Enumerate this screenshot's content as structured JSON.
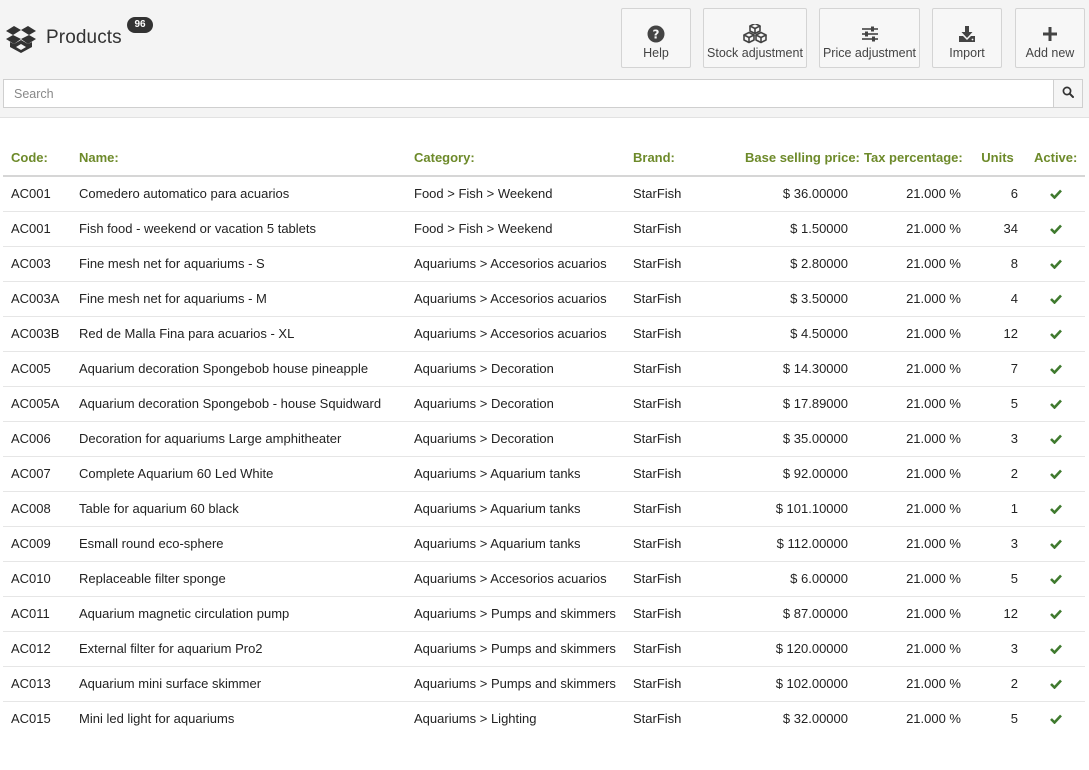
{
  "header": {
    "title": "Products",
    "count_badge": "96",
    "logo_icon": "dropbox-box-icon"
  },
  "toolbar": {
    "help_label": "Help",
    "stock_adjustment_label": "Stock adjustment",
    "price_adjustment_label": "Price adjustment",
    "import_label": "Import",
    "add_new_label": "Add new"
  },
  "search": {
    "placeholder": "Search",
    "value": ""
  },
  "colors": {
    "header_text": "#6d8a2a",
    "check": "#3f7a2e"
  },
  "table": {
    "columns": {
      "code": "Code:",
      "name": "Name:",
      "category": "Category:",
      "brand": "Brand:",
      "price": "Base selling price:",
      "tax": "Tax percentage:",
      "units": "Units",
      "active": "Active:"
    },
    "rows": [
      {
        "code": "AC001",
        "name": "Comedero automatico para acuarios",
        "category": "Food > Fish > Weekend",
        "brand": "StarFish",
        "price": "$ 36.00000",
        "tax": "21.000 %",
        "units": "6",
        "active": true
      },
      {
        "code": "AC001",
        "name": "Fish food - weekend or vacation 5 tablets",
        "category": "Food > Fish > Weekend",
        "brand": "StarFish",
        "price": "$ 1.50000",
        "tax": "21.000 %",
        "units": "34",
        "active": true
      },
      {
        "code": "AC003",
        "name": "Fine mesh net for aquariums - S",
        "category": "Aquariums > Accesorios acuarios",
        "brand": "StarFish",
        "price": "$ 2.80000",
        "tax": "21.000 %",
        "units": "8",
        "active": true
      },
      {
        "code": "AC003A",
        "name": "Fine mesh net for aquariums - M",
        "category": "Aquariums > Accesorios acuarios",
        "brand": "StarFish",
        "price": "$ 3.50000",
        "tax": "21.000 %",
        "units": "4",
        "active": true
      },
      {
        "code": "AC003B",
        "name": "Red de Malla Fina para acuarios - XL",
        "category": "Aquariums > Accesorios acuarios",
        "brand": "StarFish",
        "price": "$ 4.50000",
        "tax": "21.000 %",
        "units": "12",
        "active": true
      },
      {
        "code": "AC005",
        "name": "Aquarium decoration Spongebob house pineapple",
        "category": "Aquariums > Decoration",
        "brand": "StarFish",
        "price": "$ 14.30000",
        "tax": "21.000 %",
        "units": "7",
        "active": true
      },
      {
        "code": "AC005A",
        "name": "Aquarium decoration Spongebob - house Squidward",
        "category": "Aquariums > Decoration",
        "brand": "StarFish",
        "price": "$ 17.89000",
        "tax": "21.000 %",
        "units": "5",
        "active": true
      },
      {
        "code": "AC006",
        "name": "Decoration for aquariums Large amphitheater",
        "category": "Aquariums > Decoration",
        "brand": "StarFish",
        "price": "$ 35.00000",
        "tax": "21.000 %",
        "units": "3",
        "active": true
      },
      {
        "code": "AC007",
        "name": "Complete Aquarium 60 Led White",
        "category": "Aquariums > Aquarium tanks",
        "brand": "StarFish",
        "price": "$ 92.00000",
        "tax": "21.000 %",
        "units": "2",
        "active": true
      },
      {
        "code": "AC008",
        "name": "Table for aquarium 60 black",
        "category": "Aquariums > Aquarium tanks",
        "brand": "StarFish",
        "price": "$ 101.10000",
        "tax": "21.000 %",
        "units": "1",
        "active": true
      },
      {
        "code": "AC009",
        "name": "Esmall round eco-sphere",
        "category": "Aquariums > Aquarium tanks",
        "brand": "StarFish",
        "price": "$ 112.00000",
        "tax": "21.000 %",
        "units": "3",
        "active": true
      },
      {
        "code": "AC010",
        "name": "Replaceable filter sponge",
        "category": "Aquariums > Accesorios acuarios",
        "brand": "StarFish",
        "price": "$ 6.00000",
        "tax": "21.000 %",
        "units": "5",
        "active": true
      },
      {
        "code": "AC011",
        "name": "Aquarium magnetic circulation pump",
        "category": "Aquariums > Pumps and skimmers",
        "brand": "StarFish",
        "price": "$ 87.00000",
        "tax": "21.000 %",
        "units": "12",
        "active": true
      },
      {
        "code": "AC012",
        "name": "External filter for aquarium Pro2",
        "category": "Aquariums > Pumps and skimmers",
        "brand": "StarFish",
        "price": "$ 120.00000",
        "tax": "21.000 %",
        "units": "3",
        "active": true
      },
      {
        "code": "AC013",
        "name": "Aquarium mini surface skimmer",
        "category": "Aquariums > Pumps and skimmers",
        "brand": "StarFish",
        "price": "$ 102.00000",
        "tax": "21.000 %",
        "units": "2",
        "active": true
      },
      {
        "code": "AC015",
        "name": "Mini led light for aquariums",
        "category": "Aquariums > Lighting",
        "brand": "StarFish",
        "price": "$ 32.00000",
        "tax": "21.000 %",
        "units": "5",
        "active": true
      }
    ]
  }
}
